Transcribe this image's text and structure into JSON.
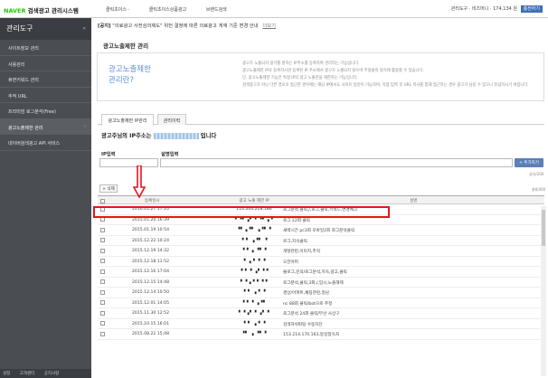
{
  "header": {
    "brand": "NAVER",
    "title": "검색광고 관리시스템",
    "nav": [
      "클릭초이스 ·",
      "클릭초이스상품광고",
      "브랜드검색"
    ],
    "right": [
      "관리도구 ·",
      "비즈머니 ·",
      "174,134 원",
      "충전하기"
    ]
  },
  "sidebar": {
    "title": "관리도구",
    "toggle": "«",
    "items": [
      {
        "label": "사이트정보 관리"
      },
      {
        "label": "사용관리"
      },
      {
        "label": "휴면키워드 관리"
      },
      {
        "label": "추적 URL"
      },
      {
        "label": "프리미엄 로그분석(Free)"
      },
      {
        "label": "광고노출제한 관리"
      },
      {
        "label": "네이버검색광고 API 서비스"
      }
    ],
    "footer": [
      "설정",
      "고객센터",
      "공지사항"
    ]
  },
  "notice": {
    "tag": "[공지]",
    "text": "\"의료광고 사전심의제도\" 위헌 결정에 따른 의료광고 게재 기준 변경 안내",
    "more": "더보기"
  },
  "page": {
    "title": "광고노출제한 관리",
    "info_title_1": "광고노출제한",
    "info_title_2": "관리란?",
    "info_lines": [
      "광고가 노출되지 않기를 원하는 IP주소를 등록하여 관리하는 기능입니다.",
      "광고노출제한 IP로 등록하시면 등록된 IP 주소에서 광고가 노출되지 않으며 부정클릭 방지에 활용할 수 있습니다.",
      "단, 광고노출제한 기능은 특정 IP의 광고 노출만을 제한하는 기능입니다.",
      "검색광고가 아닌 다른 경로로 접근한 경우에는 해당 IP에서도 사이트 방문이 가능하며, 직접 입력 후 URL 복사를 통해 접근하는 경우 광고가 남용 수 있으니 유념하시기 바랍니다."
    ],
    "tabs": [
      "광고노출제한 IP관리",
      "관리이력"
    ],
    "ip_prefix": "광고주님의 IP주소는",
    "ip_suffix": "입니다",
    "label_ip": "IP입력",
    "label_desc": "설명입력",
    "add_button": "+ 추가하기",
    "char_count": "글자/200",
    "delete_button": "× 삭제",
    "total": "총8/400"
  },
  "table": {
    "headers": [
      "등록일시",
      "광고 노출 제한 IP",
      "설명"
    ],
    "rows": [
      {
        "date": "2016.01.27 17:10",
        "ip": "114.200.228.186",
        "desc": "로그분석,클릭,/,로그,클릭,키워드,변경체크"
      },
      {
        "date": "2015.01.20 16:39",
        "ip": "▘▝▘▗▘▝ ▝▘▗▝",
        "desc": "로그 22회 클릭"
      },
      {
        "date": "2015.01.19 10:54",
        "ip": "▝▘▗▝▘ ▗▝▘▝",
        "desc": "새벽시간 pc3회 모바일2회 로그분석클릭"
      },
      {
        "date": "2015.12.22 10:24",
        "ip": "▝ ▘ ▗▝▘ ▝",
        "desc": "로그,지속클릭"
      },
      {
        "date": "2015.12.19 14:32",
        "ip": "▝ ▘▗ ▝▘▝",
        "desc": "개발관련,이미지,추적"
      },
      {
        "date": "2015.12.18 11:52",
        "ip": "▝ ▗ ▘▝ ▝",
        "desc": "오전아퍼"
      },
      {
        "date": "2015.12.16 17:04",
        "ip": "▝ ▘▝ ▗▘▝▝",
        "desc": "불로그,문의/로그분석,지속,광고,클릭"
      },
      {
        "date": "2015.12.15 14:48",
        "ip": "▘▝▗▝ ▘▝▝",
        "desc": "로그분석,클릭,3회,/,입시,노출해제"
      },
      {
        "date": "2015.12.14 10:50",
        "ip": "▝ ▘ ▗▝ ▝",
        "desc": "경상/아파트,채팅관련,정남"
      },
      {
        "date": "2015.12.01 14:05",
        "ip": "▝ ▘▝ ▗▝▘",
        "desc": "nc 88회 클릭/bot으로 추정"
      },
      {
        "date": "2015.11.30 12:52",
        "ip": "▘▝▗▘▝ ▗▘▝",
        "desc": "로그분석 24회 클릭/부산 사상구"
      },
      {
        "date": "2015.10.15 16:01",
        "ip": "▝ ▘ ▗▝ ▝",
        "desc": "검색자쉬펴팅 수동차단"
      },
      {
        "date": "2015.08.22 15:48",
        "ip": "▝▘ ▗ ▝▘▝",
        "desc": "153.214.170.163,동일접속자"
      }
    ]
  },
  "colors": {
    "highlight": "#e8141b",
    "sidebar": "#4a4d52",
    "accent": "#5b7fb8"
  }
}
